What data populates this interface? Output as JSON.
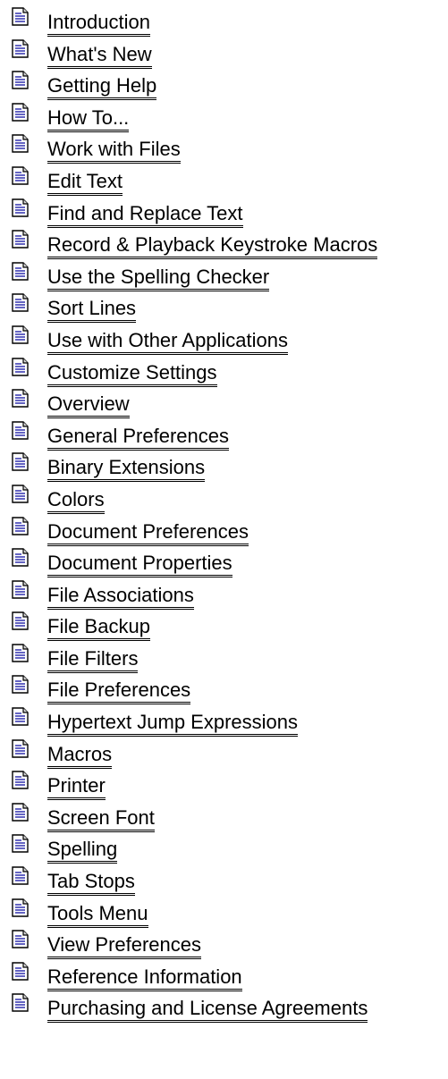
{
  "topics": [
    {
      "label": "Introduction",
      "icon": "document-icon"
    },
    {
      "label": "What's New",
      "icon": "document-icon"
    },
    {
      "label": "Getting Help",
      "icon": "document-icon"
    },
    {
      "label": "How To...",
      "icon": "document-icon"
    },
    {
      "label": "Work with Files",
      "icon": "document-icon"
    },
    {
      "label": "Edit Text",
      "icon": "document-icon"
    },
    {
      "label": "Find and Replace Text",
      "icon": "document-icon"
    },
    {
      "label": "Record & Playback Keystroke Macros",
      "icon": "document-icon"
    },
    {
      "label": "Use the Spelling Checker",
      "icon": "document-icon"
    },
    {
      "label": "Sort Lines",
      "icon": "document-icon"
    },
    {
      "label": "Use with Other Applications",
      "icon": "document-icon"
    },
    {
      "label": "Customize Settings",
      "icon": "document-icon"
    },
    {
      "label": "Overview",
      "icon": "document-icon"
    },
    {
      "label": "General Preferences",
      "icon": "document-icon"
    },
    {
      "label": "Binary Extensions",
      "icon": "document-icon"
    },
    {
      "label": "Colors",
      "icon": "document-icon"
    },
    {
      "label": "Document Preferences",
      "icon": "document-icon"
    },
    {
      "label": "Document Properties",
      "icon": "document-icon"
    },
    {
      "label": "File Associations",
      "icon": "document-icon"
    },
    {
      "label": "File Backup",
      "icon": "document-icon"
    },
    {
      "label": "File Filters",
      "icon": "document-icon"
    },
    {
      "label": "File Preferences",
      "icon": "document-icon"
    },
    {
      "label": "Hypertext Jump Expressions",
      "icon": "document-icon"
    },
    {
      "label": "Macros",
      "icon": "document-icon"
    },
    {
      "label": "Printer",
      "icon": "document-icon"
    },
    {
      "label": "Screen Font",
      "icon": "document-icon"
    },
    {
      "label": "Spelling",
      "icon": "document-icon"
    },
    {
      "label": "Tab Stops",
      "icon": "document-icon"
    },
    {
      "label": "Tools Menu",
      "icon": "document-icon"
    },
    {
      "label": "View Preferences",
      "icon": "document-icon"
    },
    {
      "label": "Reference Information",
      "icon": "document-icon"
    },
    {
      "label": "Purchasing and License Agreements",
      "icon": "document-icon"
    }
  ],
  "colors": {
    "background": "#ffffff",
    "link_text": "#000000",
    "icon_lines": "#1010a0"
  }
}
